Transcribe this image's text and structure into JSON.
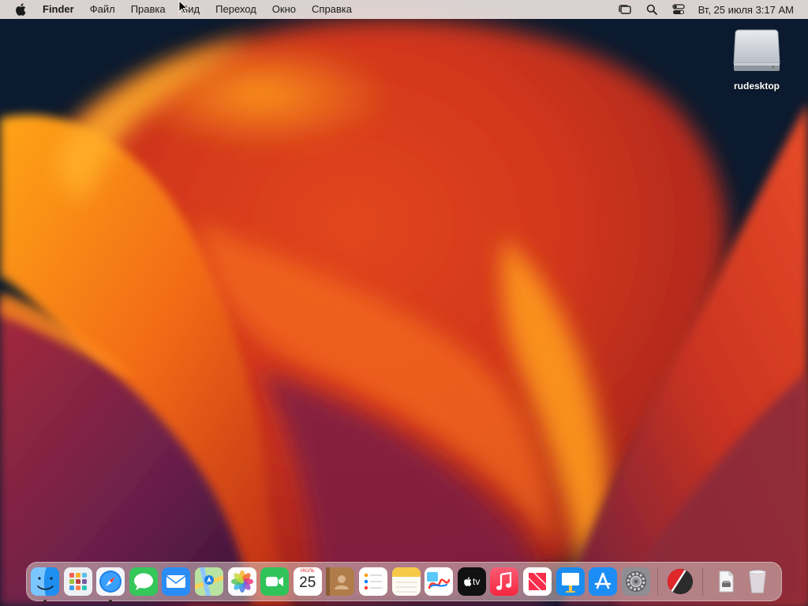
{
  "menubar": {
    "app_name": "Finder",
    "menus": [
      "Файл",
      "Правка",
      "Вид",
      "Переход",
      "Окно",
      "Справка"
    ],
    "status_icons": [
      "stage-manager-icon",
      "search-icon",
      "control-center-icon"
    ],
    "clock": "Вт, 25 июля  3:17 AM"
  },
  "desktop": {
    "disk_label": "rudesktop"
  },
  "dock": {
    "apps": [
      {
        "name": "finder",
        "running": true
      },
      {
        "name": "launchpad",
        "running": false
      },
      {
        "name": "safari",
        "running": true
      },
      {
        "name": "messages",
        "running": false
      },
      {
        "name": "mail",
        "running": false
      },
      {
        "name": "maps",
        "running": false
      },
      {
        "name": "photos",
        "running": false
      },
      {
        "name": "facetime",
        "running": false
      },
      {
        "name": "calendar",
        "running": false
      },
      {
        "name": "contacts",
        "running": false
      },
      {
        "name": "reminders",
        "running": false
      },
      {
        "name": "notes",
        "running": false
      },
      {
        "name": "freeform",
        "running": false
      },
      {
        "name": "apple-tv",
        "running": false
      },
      {
        "name": "music",
        "running": false
      },
      {
        "name": "news",
        "running": false
      },
      {
        "name": "keynote",
        "running": false
      },
      {
        "name": "app-store",
        "running": false
      },
      {
        "name": "system-settings",
        "running": false
      }
    ],
    "calendar_month": "ИЮЛЬ",
    "calendar_day": "25",
    "tv_label": "tv"
  },
  "colors": {
    "menubar_bg": "#ece2de",
    "wallpaper_dark": "#0b1a2e",
    "wallpaper_orange": "#f36a1c",
    "wallpaper_red": "#c02a18",
    "wallpaper_purple": "#6a1f4a"
  }
}
